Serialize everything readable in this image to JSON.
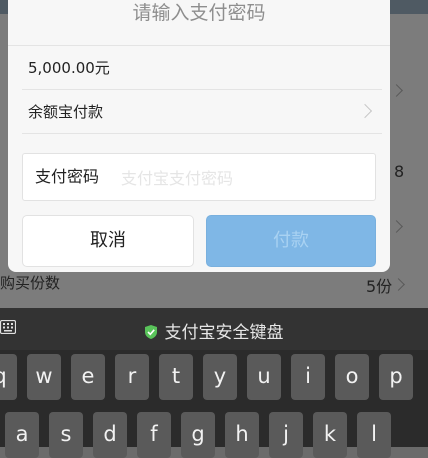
{
  "dialog": {
    "title": "请输入支付密码",
    "amount": "5,000.00元",
    "payment_method": "余额宝付款",
    "password_label": "支付密码",
    "password_placeholder": "支付宝支付密码",
    "cancel_label": "取消",
    "pay_label": "付款"
  },
  "background": {
    "purchase_qty_label": "购买份数",
    "purchase_qty_value": "5份",
    "side_number": "8"
  },
  "keyboard": {
    "title": "支付宝安全键盘",
    "row1": [
      "q",
      "w",
      "e",
      "r",
      "t",
      "y",
      "u",
      "i",
      "o",
      "p"
    ],
    "row2": [
      "a",
      "s",
      "d",
      "f",
      "g",
      "h",
      "j",
      "k",
      "l"
    ]
  },
  "colors": {
    "pay_button": "#7fb7e6",
    "keyboard_bg": "#2b2b2b",
    "key_bg": "#5a5a5a",
    "shield": "#59c35a"
  }
}
